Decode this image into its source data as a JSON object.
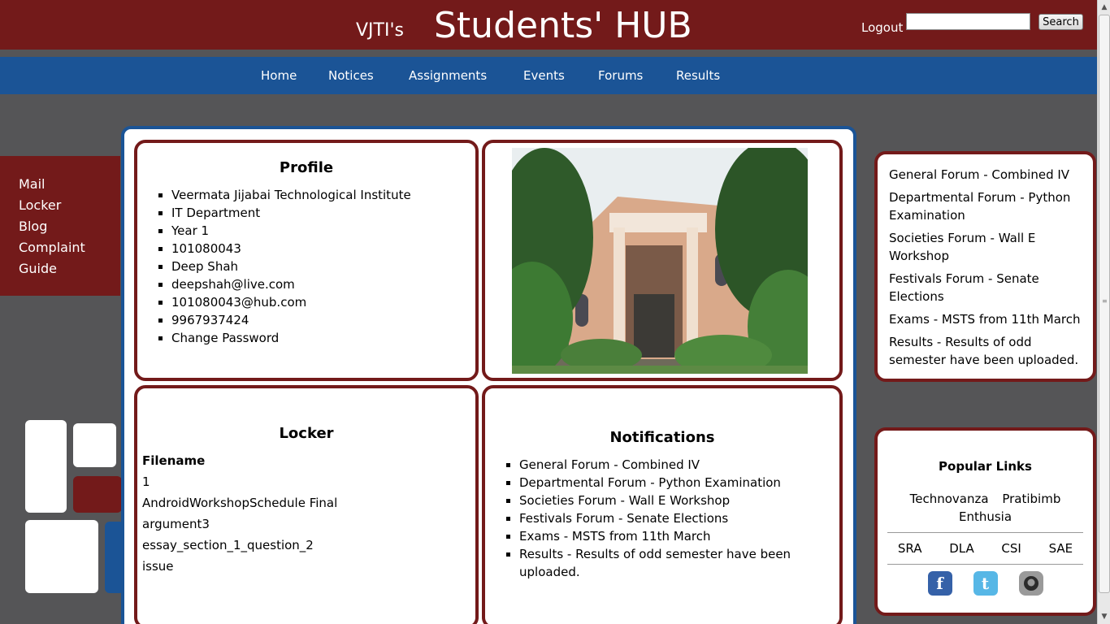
{
  "header": {
    "brand_small": "VJTI's",
    "brand_big": "Students' HUB",
    "logout": "Logout",
    "search_value": "",
    "search_button": "Search"
  },
  "nav": {
    "items": [
      "Home",
      "Notices",
      "Assignments",
      "Events",
      "Forums",
      "Results"
    ]
  },
  "sidebar": {
    "items": [
      "Mail",
      "Locker",
      "Blog",
      "Complaint",
      "Guide"
    ]
  },
  "profile": {
    "title": "Profile",
    "items": [
      "Veermata Jijabai Technological Institute",
      "IT Department",
      "Year 1",
      "101080043",
      "Deep Shah",
      "deepshah@live.com",
      "101080043@hub.com",
      "9967937424",
      "Change Password"
    ]
  },
  "locker": {
    "title": "Locker",
    "header": "Filename",
    "files": [
      "1",
      "AndroidWorkshopSchedule Final",
      "argument3",
      "essay_section_1_question_2",
      "issue"
    ]
  },
  "notifications": {
    "title": "Notifications",
    "items": [
      "General Forum - Combined IV",
      "Departmental Forum - Python Examination",
      "Societies Forum - Wall E Workshop",
      "Festivals Forum - Senate Elections",
      "Exams - MSTS from 11th March",
      "Results - Results of odd semester have been uploaded."
    ]
  },
  "news": {
    "items": [
      "General Forum - Combined IV",
      "Departmental Forum - Python Examination",
      "Societies Forum - Wall E Workshop",
      "Festivals Forum - Senate Elections",
      "Exams - MSTS from 11th March",
      "Results - Results of odd semester have been uploaded."
    ]
  },
  "popular_links": {
    "title": "Popular Links",
    "row1": [
      "Technovanza",
      "Pratibimb",
      "Enthusia"
    ],
    "row2": [
      "SRA",
      "DLA",
      "CSI",
      "SAE"
    ],
    "social_icons": [
      "facebook-icon",
      "twitter-icon",
      "github-icon"
    ]
  },
  "colors": {
    "maroon": "#731a1a",
    "blue": "#1b5496",
    "background": "#555557"
  }
}
